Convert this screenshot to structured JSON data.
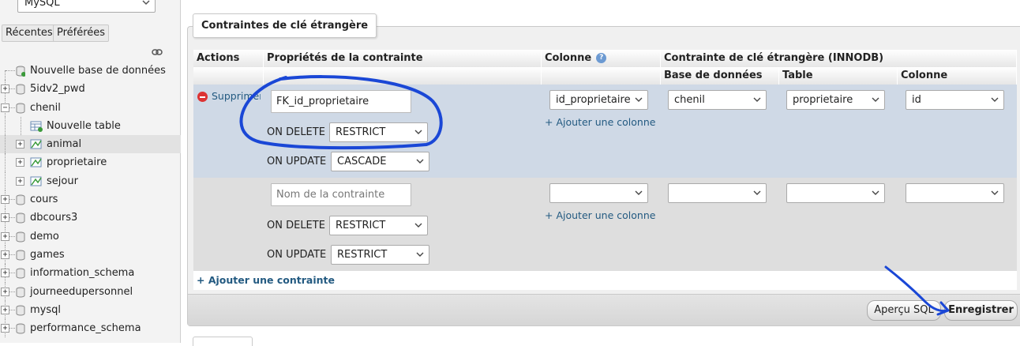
{
  "sidebar": {
    "server_select": "MySQL",
    "tabs": [
      {
        "label": "Récentes"
      },
      {
        "label": "Préférées"
      }
    ],
    "tree": [
      {
        "label": "Nouvelle base de données",
        "level": 0,
        "expander": ""
      },
      {
        "label": "5idv2_pwd",
        "level": 0,
        "expander": "+"
      },
      {
        "label": "chenil",
        "level": 0,
        "expander": "−"
      },
      {
        "label": "Nouvelle table",
        "level": 1,
        "expander": ""
      },
      {
        "label": "animal",
        "level": 1,
        "expander": "+",
        "selected": true
      },
      {
        "label": "proprietaire",
        "level": 1,
        "expander": "+"
      },
      {
        "label": "sejour",
        "level": 1,
        "expander": "+"
      },
      {
        "label": "cours",
        "level": 0,
        "expander": "+"
      },
      {
        "label": "dbcours3",
        "level": 0,
        "expander": "+"
      },
      {
        "label": "demo",
        "level": 0,
        "expander": "+"
      },
      {
        "label": "games",
        "level": 0,
        "expander": "+"
      },
      {
        "label": "information_schema",
        "level": 0,
        "expander": "+"
      },
      {
        "label": "journeedupersonnel",
        "level": 0,
        "expander": "+"
      },
      {
        "label": "mysql",
        "level": 0,
        "expander": "+"
      },
      {
        "label": "performance_schema",
        "level": 0,
        "expander": "+"
      }
    ]
  },
  "panel": {
    "legend": "Contraintes de clé étrangère",
    "headers": {
      "actions": "Actions",
      "properties": "Propriétés de la contrainte",
      "column": "Colonne",
      "fk_constraint": "Contrainte de clé étrangère (INNODB)",
      "database": "Base de données",
      "table": "Table",
      "fk_column": "Colonne"
    },
    "rows": [
      {
        "delete_label": "Supprimer",
        "constraint_name": "FK_id_proprietaire",
        "on_delete_label": "ON DELETE",
        "on_delete": "RESTRICT",
        "on_update_label": "ON UPDATE",
        "on_update": "CASCADE",
        "column": "id_proprietaire",
        "add_column": "+ Ajouter une colonne",
        "ref_database": "chenil",
        "ref_table": "proprietaire",
        "ref_column": "id"
      },
      {
        "constraint_placeholder": "Nom de la contrainte",
        "on_delete_label": "ON DELETE",
        "on_delete": "RESTRICT",
        "on_update_label": "ON UPDATE",
        "on_update": "RESTRICT",
        "column": "",
        "add_column": "+ Ajouter une colonne",
        "ref_database": "",
        "ref_table": "",
        "ref_column": ""
      }
    ],
    "add_constraint": "+ Ajouter une contrainte"
  },
  "footer": {
    "preview_sql": "Aperçu SQL",
    "save": "Enregistrer"
  },
  "colors": {
    "row1_bg": "#cfd9e6",
    "row2_bg": "#dedede",
    "annotation": "#1a47d6",
    "link": "#235a81"
  }
}
